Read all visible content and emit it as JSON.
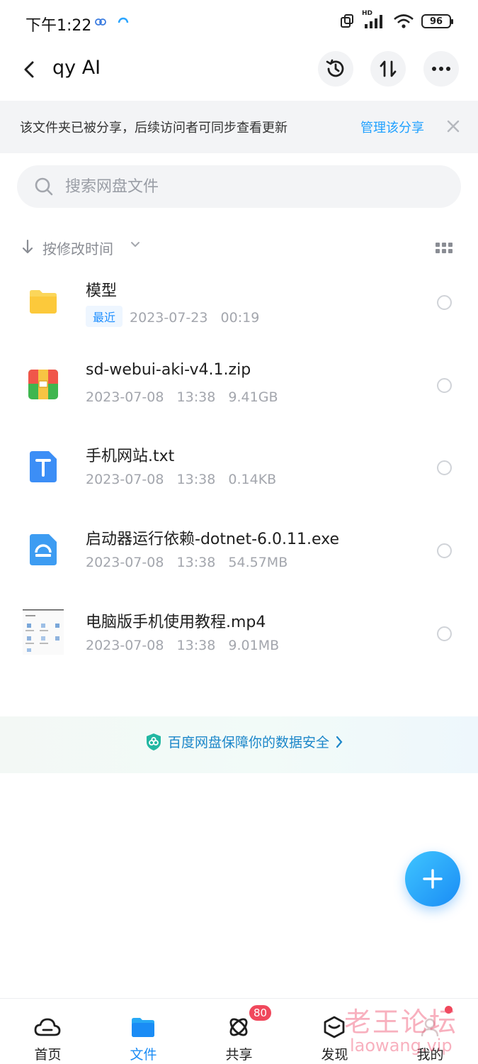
{
  "status_bar": {
    "time": "下午1:22",
    "network_label": "HD",
    "battery": "96"
  },
  "header": {
    "title": "qy AI",
    "back_icon": "back-chevron-icon",
    "actions": [
      "history-icon",
      "transfer-icon",
      "more-icon"
    ]
  },
  "share_banner": {
    "text": "该文件夹已被分享，后续访问者可同步查看更新",
    "link": "管理该分享",
    "close_icon": "close-icon"
  },
  "search": {
    "placeholder": "搜索网盘文件"
  },
  "sort": {
    "label": "按修改时间"
  },
  "files": [
    {
      "name": "模型",
      "badge": "最近",
      "meta": "2023-07-23   00:19",
      "icon": "folder-icon"
    },
    {
      "name": "sd-webui-aki-v4.1.zip",
      "badge": "",
      "meta": "2023-07-08   13:38   9.41GB",
      "icon": "zip-file-icon"
    },
    {
      "name": "手机网站.txt",
      "badge": "",
      "meta": "2023-07-08   13:38   0.14KB",
      "icon": "text-file-icon"
    },
    {
      "name": "启动器运行依赖-dotnet-6.0.11.exe",
      "badge": "",
      "meta": "2023-07-08   13:38   54.57MB",
      "icon": "exe-file-icon"
    },
    {
      "name": "电脑版手机使用教程.mp4",
      "badge": "",
      "meta": "2023-07-08   13:38   9.01MB",
      "icon": "video-thumbnail"
    }
  ],
  "security": {
    "text": "百度网盘保障你的数据安全"
  },
  "bottom_nav": {
    "items": [
      {
        "label": "首页",
        "icon": "home-cloud-icon",
        "active": false
      },
      {
        "label": "文件",
        "icon": "folder-icon",
        "active": true
      },
      {
        "label": "共享",
        "icon": "share-orbit-icon",
        "active": false
      },
      {
        "label": "发现",
        "icon": "discover-box-icon",
        "active": false
      },
      {
        "label": "我的",
        "icon": "profile-icon",
        "active": false
      }
    ],
    "share_badge": "80"
  },
  "watermark": {
    "line1": "老王论坛",
    "line2": "laowang.vip"
  },
  "colors": {
    "accent": "#1a8cf5",
    "link": "#1fa0ff",
    "badge_red": "#f0485c",
    "meta_gray": "#a3a6ad"
  }
}
